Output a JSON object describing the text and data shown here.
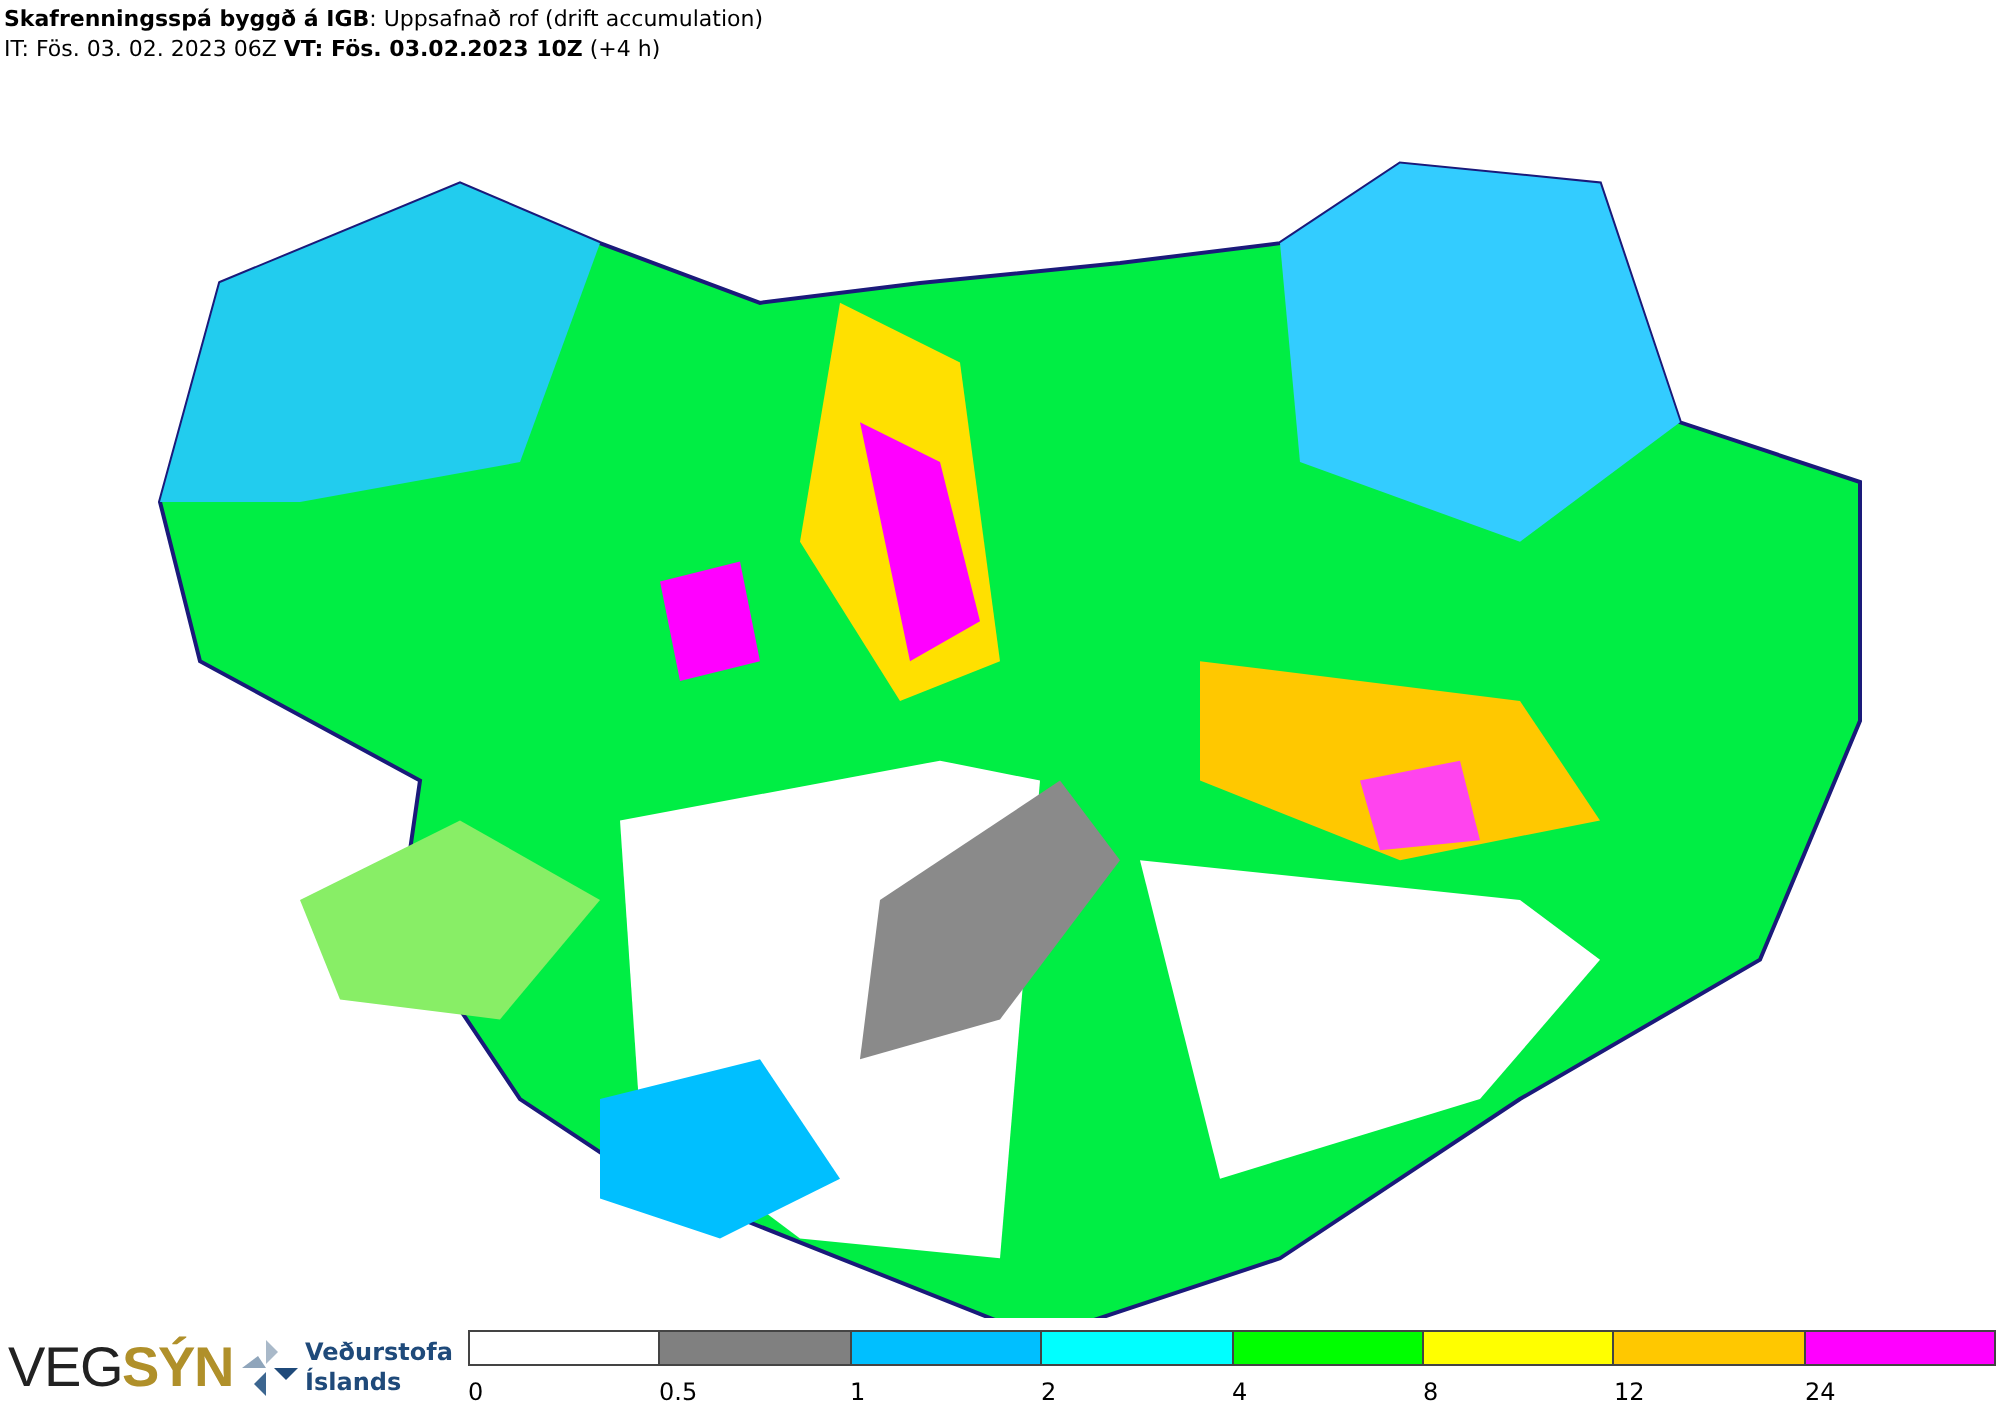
{
  "header": {
    "title": "**Skafrenningsspá byggð á IGB**: Uppsafnað rof (drift accumulation)",
    "times": "IT: Fös. 03. 02. 2023 06Z **VT: Fös. 03.02.2023 10Z** (+4 h)"
  },
  "logos": {
    "vegsyn_a": "VEG",
    "vegsyn_b": "SÝN",
    "vedur_1": "Veðurstofa",
    "vedur_2": "Íslands"
  },
  "legend": [
    {
      "label": "0",
      "color": "#ffffff"
    },
    {
      "label": "0.5",
      "color": "#808080"
    },
    {
      "label": "1",
      "color": "#00bfff"
    },
    {
      "label": "2",
      "color": "#00ffff"
    },
    {
      "label": "4",
      "color": "#00ff00"
    },
    {
      "label": "8",
      "color": "#ffff00"
    },
    {
      "label": "12",
      "color": "#ffc800"
    },
    {
      "label": "24",
      "color": "#ff00ff"
    }
  ]
}
